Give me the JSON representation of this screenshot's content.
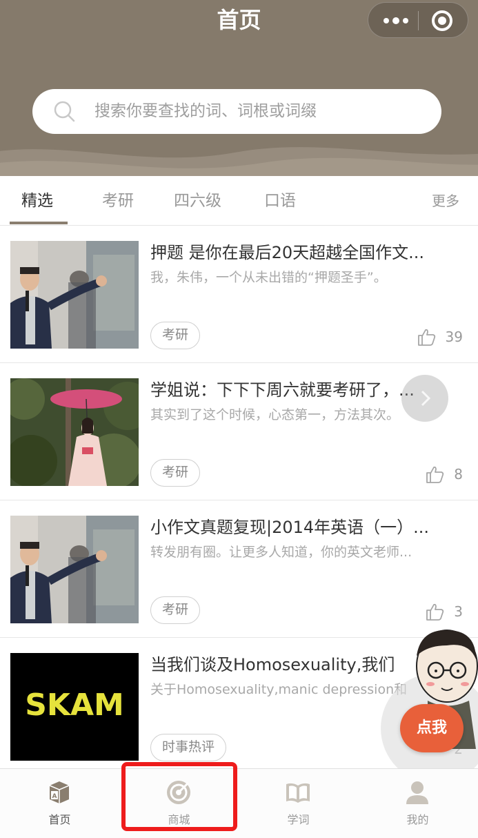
{
  "header": {
    "title": "首页",
    "search_placeholder": "搜索你要查找的词、词根或词缀",
    "colors": {
      "header_bg": "#857a6b",
      "accent": "#8a7e6f"
    }
  },
  "tabs": {
    "items": [
      {
        "label": "精选",
        "active": true
      },
      {
        "label": "考研"
      },
      {
        "label": "四六级"
      },
      {
        "label": "口语"
      }
    ],
    "more_label": "更多"
  },
  "feed": [
    {
      "title": "押题 是你在最后20天超越全国作文...",
      "desc": "我，朱伟，一个从未出错的“押题圣手”。",
      "tag": "考研",
      "likes": "39",
      "thumb": "speaker"
    },
    {
      "title": "学姐说：下下下周六就要考研了，...",
      "desc": "其实到了这个时候，心态第一，方法其次。",
      "tag": "考研",
      "likes": "8",
      "thumb": "umbrella"
    },
    {
      "title": "小作文真题复现|2014年英语（一）...",
      "desc": "转发朋有圈。让更多人知道，你的英文老师...",
      "tag": "考研",
      "likes": "3",
      "thumb": "speaker"
    },
    {
      "title": "当我们谈及Homosexuality,我们",
      "desc": "关于Homosexuality,manic depression和",
      "tag": "时事热评",
      "likes": "2",
      "thumb": "skam",
      "thumb_text": "SKAM"
    }
  ],
  "floating": {
    "cta_label": "点我"
  },
  "bottom_nav": [
    {
      "label": "首页",
      "icon": "cube-a-icon"
    },
    {
      "label": "商城",
      "icon": "radar-icon"
    },
    {
      "label": "学词",
      "icon": "book-icon"
    },
    {
      "label": "我的",
      "icon": "person-icon"
    }
  ]
}
